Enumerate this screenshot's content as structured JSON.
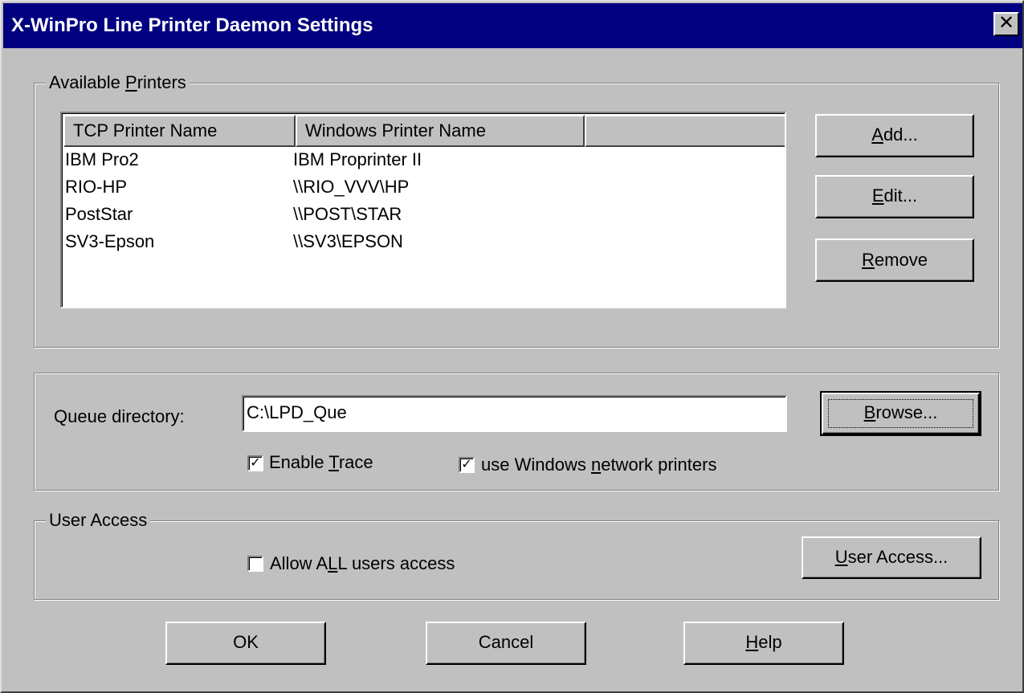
{
  "window": {
    "title": "X-WinPro Line Printer Daemon Settings",
    "close_glyph": "✕"
  },
  "printers_group": {
    "legend": "Available Printers",
    "columns": [
      "TCP Printer Name",
      "Windows Printer Name",
      ""
    ],
    "rows": [
      {
        "tcp": "IBM Pro2",
        "windows": "IBM Proprinter II"
      },
      {
        "tcp": "RIO-HP",
        "windows": "\\\\RIO_VVV\\HP"
      },
      {
        "tcp": "PostStar",
        "windows": "\\\\POST\\STAR"
      },
      {
        "tcp": "SV3-Epson",
        "windows": "\\\\SV3\\EPSON"
      }
    ],
    "add_label": "Add...",
    "edit_label": "Edit...",
    "remove_label": "Remove"
  },
  "queue_group": {
    "queue_label": "Queue directory:",
    "queue_value": "C:\\LPD_Que",
    "browse_label": "Browse...",
    "enable_trace_label": "Enable Trace",
    "enable_trace_checked": true,
    "network_printers_label": "use Windows network printers",
    "network_printers_checked": true
  },
  "user_access_group": {
    "legend": "User Access",
    "allow_all_label": "Allow ALL users access",
    "allow_all_checked": false,
    "user_access_button": "User Access..."
  },
  "footer": {
    "ok_label": "OK",
    "cancel_label": "Cancel",
    "help_label": "Help"
  },
  "colors": {
    "title_bar": "#000080",
    "face": "#c0c0c0"
  }
}
